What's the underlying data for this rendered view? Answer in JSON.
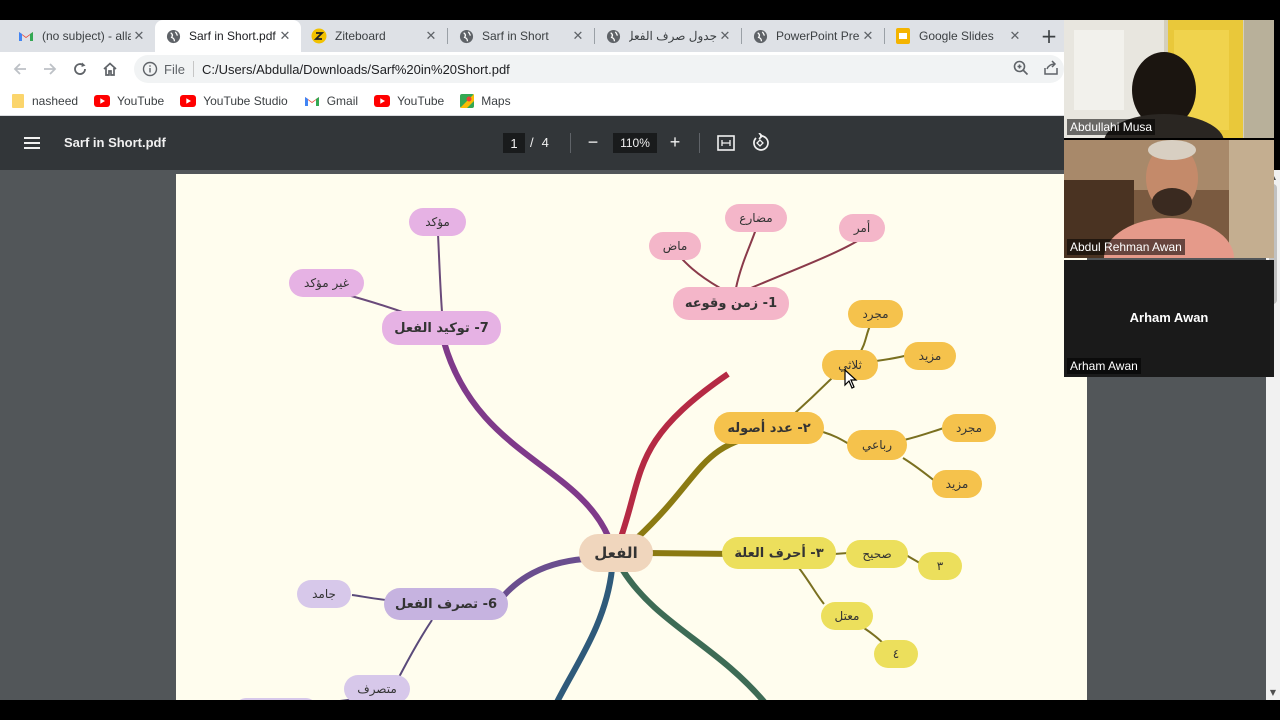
{
  "browser": {
    "tabs": [
      {
        "label": "(no subject) - alla",
        "icon": "gmail-icon",
        "active": false
      },
      {
        "label": "Sarf in Short.pdf",
        "icon": "globe-icon",
        "active": true
      },
      {
        "label": "Ziteboard",
        "icon": "ziteboard-icon",
        "active": false
      },
      {
        "label": "Sarf in Short",
        "icon": "globe-icon",
        "active": false
      },
      {
        "label": "جدول صرف الفعل",
        "icon": "globe-icon",
        "active": false
      },
      {
        "label": "PowerPoint Prese",
        "icon": "globe-icon",
        "active": false
      },
      {
        "label": "Google Slides",
        "icon": "slides-icon",
        "active": false
      }
    ],
    "scheme": "File",
    "url": "C:/Users/Abdulla/Downloads/Sarf%20in%20Short.pdf",
    "bookmarks": [
      {
        "label": "nasheed",
        "icon": "folder-icon"
      },
      {
        "label": "YouTube",
        "icon": "youtube-icon"
      },
      {
        "label": "YouTube Studio",
        "icon": "youtube-icon"
      },
      {
        "label": "Gmail",
        "icon": "gmail-icon"
      },
      {
        "label": "YouTube",
        "icon": "youtube-icon"
      },
      {
        "label": "Maps",
        "icon": "maps-icon"
      }
    ]
  },
  "pdf": {
    "title": "Sarf in Short.pdf",
    "current_page": "1",
    "page_separator": "/",
    "total_pages": "4",
    "zoom": "110%"
  },
  "mindmap": {
    "center": "الفعل",
    "n1_main": "1- زمن وقوعه",
    "n1_madi": "ماض",
    "n1_mudari": "مضارع",
    "n1_amr": "أمر",
    "n2_main": "٢- عدد أصوله",
    "n2_thulathi": "ثلاثي",
    "n2_mujarrad1": "مجرد",
    "n2_mazid1": "مزيد",
    "n2_rubai": "رباعي",
    "n2_mujarrad2": "مجرد",
    "n2_mazid2": "مزيد",
    "n3_main": "٣- أحرف العلة",
    "n3_sahih": "صحيح",
    "n3_three": "٣",
    "n3_mutal": "معتل",
    "n3_four": "٤",
    "n6_main": "6- تصرف الفعل",
    "n6_jamid": "جامد",
    "n6_mutasarrif": "متصرف",
    "n7_main": "7- توكيد الفعل",
    "n7_muakkad": "مؤكد",
    "n7_ghayr": "غير مؤكد",
    "colors": {
      "pink": "#f4b6c9",
      "orange": "#f5c24c",
      "yellow": "#ecdf5c",
      "purple": "#c6b3e0",
      "magenta": "#e6b2e4",
      "center": "#f0d6bd"
    }
  },
  "participants": [
    {
      "name": "Abdullahi Musa",
      "video": true
    },
    {
      "name": "Abdul Rehman Awan",
      "video": true
    },
    {
      "name": "Arham Awan",
      "video": false,
      "display": "Arham Awan"
    }
  ]
}
